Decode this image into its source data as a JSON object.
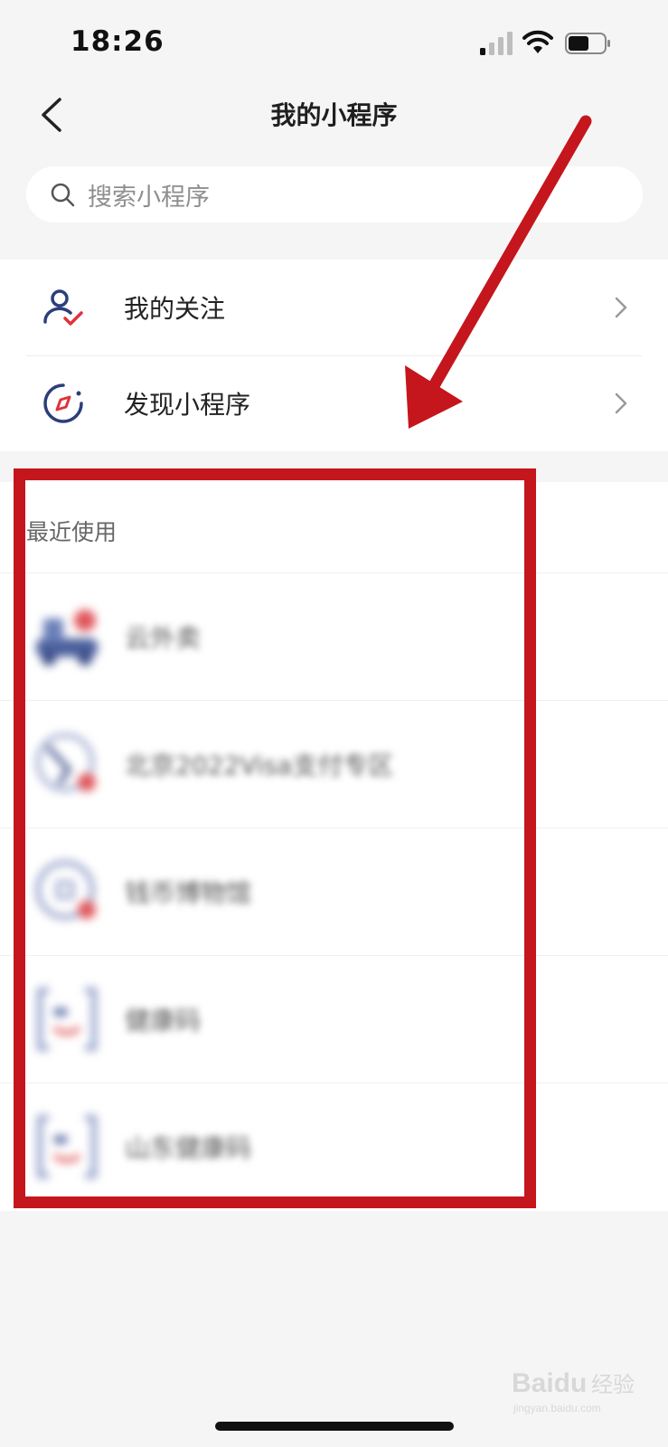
{
  "status_bar": {
    "time": "18:26"
  },
  "nav": {
    "title": "我的小程序"
  },
  "search": {
    "placeholder": "搜索小程序"
  },
  "menu": {
    "items": [
      {
        "label": "我的关注",
        "icon": "user-check-icon"
      },
      {
        "label": "发现小程序",
        "icon": "compass-icon"
      }
    ]
  },
  "recent": {
    "title": "最近使用",
    "items": [
      {
        "name": "云外卖",
        "icon": "delivery-truck-icon"
      },
      {
        "name": "北京2022Visa支付专区",
        "icon": "globe-icon"
      },
      {
        "name": "钱币博物馆",
        "icon": "coin-icon"
      },
      {
        "name": "健康码",
        "icon": "qr-health-icon"
      },
      {
        "name": "山东健康码",
        "icon": "qr-health-icon"
      }
    ]
  },
  "annotation": {
    "color": "#c4161c"
  },
  "watermark": {
    "brand": "Baidu",
    "suffix": "经验",
    "url": "jingyan.baidu.com"
  },
  "colors": {
    "accent_navy": "#2c3e7a",
    "accent_red": "#e0333a"
  }
}
